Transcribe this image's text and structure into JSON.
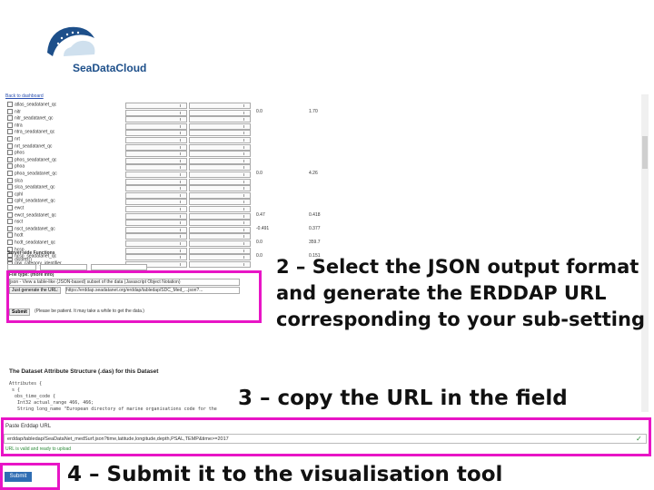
{
  "header": {
    "logo_text": "SeaDataCloud"
  },
  "panel": {
    "back_link": "Back to dashboard",
    "variables": [
      "atlas_seadatanet_qc",
      "nitr",
      "nitr_seadatanet_qc",
      "ntra",
      "ntra_seadatanet_qc",
      "nrt",
      "nrt_seadatanet_qc",
      "phos",
      "phos_seadatanet_qc",
      "phoa",
      "phoa_seadatanet_qc",
      "slca",
      "slca_seadatanet_qc",
      "cphl",
      "cphl_seadatanet_qc",
      "ewct",
      "ewct_seadatanet_qc",
      "nsct",
      "nsct_seadatanet_qc",
      "hcdt",
      "hcdt_seadatanet_qc",
      "hcsp",
      "hcsp_seadatanet_qc",
      "raw_category_identifier"
    ],
    "numbers": [
      {
        "row": 1,
        "min": "0.0",
        "max": "1.70"
      },
      {
        "row": 10,
        "min": "0.0",
        "max": "4.26"
      },
      {
        "row": 16,
        "min": "0.47",
        "max": "0.418"
      },
      {
        "row": 18,
        "min": "-0.491",
        "max": "0.377"
      },
      {
        "row": 20,
        "min": "0.0",
        "max": "359.7"
      },
      {
        "row": 22,
        "min": "0.0",
        "max": "0.151"
      }
    ],
    "server_side_functions": "Server-side Functions",
    "distinct_label": "distinct()",
    "file_type_label": "File type: (more info)",
    "file_type_value": "json - View a table-like (JSON-based) subset of the data (Javascript Object Notation)",
    "generate_url_button": "Just generate the URL:",
    "generated_url": "https://erddap.seadatanet.org/erddap/tabledap/SDC_Med_...json?...",
    "submit_button": "Submit",
    "submit_note": "(Please be patient. It may take a while to get the data.)",
    "das_heading": "The Dataset Attribute Structure (.das) for this Dataset",
    "das_lines": [
      "Attributes {",
      " s {",
      "  obs_time_code {",
      "   Int32 actual_range 466, 466;",
      "   String long_name \"European directory of marine organisations code for the"
    ]
  },
  "erddap_url": {
    "label": "Paste Erddap URL",
    "value": "erddap/tabledap/SeaDataNet_medSurf.json?time,latitude,longitude,depth,PSAL,TEMP&time>=2017",
    "hint": "URL is valid and ready to upload"
  },
  "submit_tool_button": "Submit",
  "steps": {
    "step2": "2 – Select the JSON output format and generate the ERDDAP URL corresponding to your sub-setting",
    "step3": "3 – copy the URL in the field",
    "step4": "4 – Submit it to the visualisation tool"
  }
}
